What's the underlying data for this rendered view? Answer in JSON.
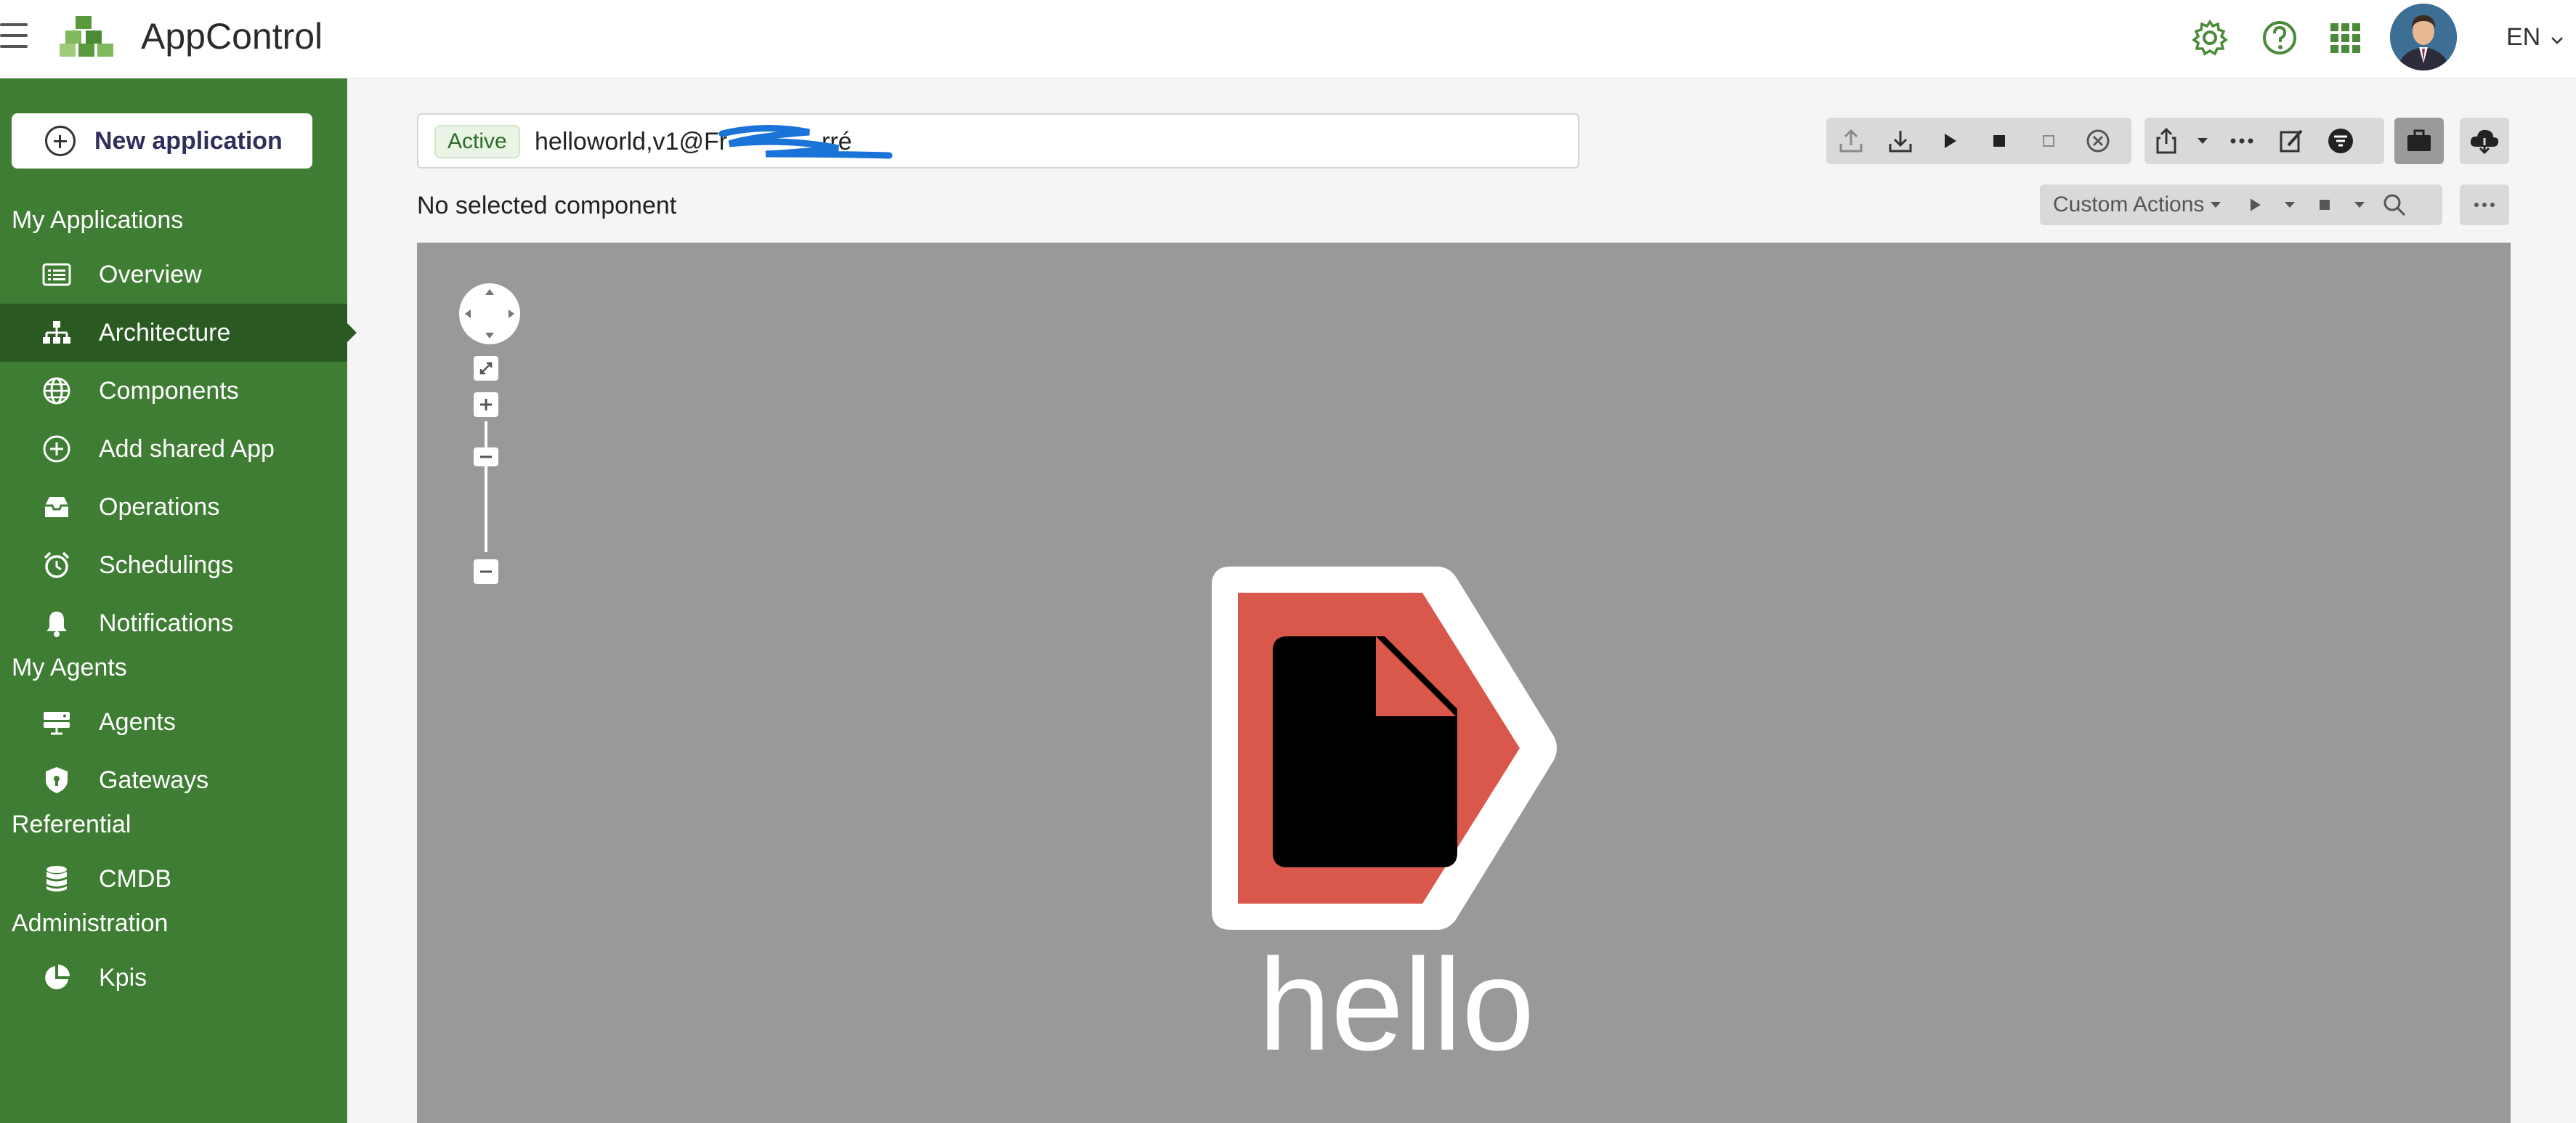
{
  "header": {
    "app_title": "AppControl",
    "language": "EN",
    "icons": [
      "menu-icon",
      "appcontrol-logo",
      "settings-icon",
      "help-icon",
      "apps-grid-icon",
      "user-avatar"
    ]
  },
  "sidebar": {
    "new_app_label": "New application",
    "sections": {
      "applications": "My Applications",
      "agents": "My Agents",
      "referential": "Referential",
      "administration": "Administration"
    },
    "items": [
      {
        "label": "Overview",
        "icon": "list-icon"
      },
      {
        "label": "Architecture",
        "icon": "hierarchy-icon",
        "active": true
      },
      {
        "label": "Components",
        "icon": "globe-icon"
      },
      {
        "label": "Add shared App",
        "icon": "add-circle-icon"
      },
      {
        "label": "Operations",
        "icon": "inbox-icon"
      },
      {
        "label": "Schedulings",
        "icon": "alarm-clock-icon"
      },
      {
        "label": "Notifications",
        "icon": "bell-icon"
      },
      {
        "label": "Agents",
        "icon": "server-icon"
      },
      {
        "label": "Gateways",
        "icon": "shield-icon"
      },
      {
        "label": "CMDB",
        "icon": "database-icon"
      },
      {
        "label": "Kpis",
        "icon": "pie-chart-icon"
      }
    ]
  },
  "main": {
    "status_badge": "Active",
    "search_value": "helloworld,v1@Fr",
    "search_value_tail": "rré",
    "selection_status": "No selected component",
    "custom_actions_label": "Custom Actions",
    "component_label": "hello",
    "colors": {
      "sidebar": "#3e7d33",
      "sidebar_active": "#2a5a22",
      "canvas": "#999999",
      "component_fill": "#d9574b",
      "scribble": "#1a73d9"
    }
  }
}
